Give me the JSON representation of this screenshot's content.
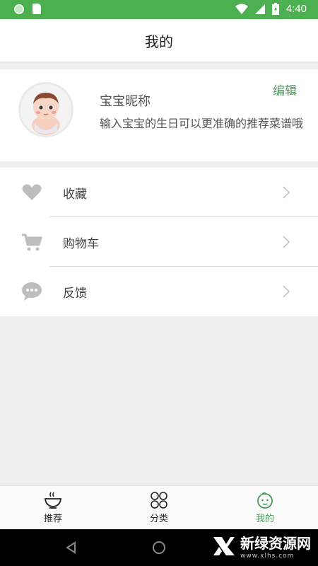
{
  "status_bar": {
    "time": "4:40"
  },
  "header": {
    "title": "我的"
  },
  "profile": {
    "nickname": "宝宝昵称",
    "edit_label": "编辑",
    "birthday_hint": "输入宝宝的生日可以更准确的推荐菜谱哦"
  },
  "menu": {
    "items": [
      {
        "label": "收藏",
        "icon": "heart-icon"
      },
      {
        "label": "购物车",
        "icon": "cart-icon"
      },
      {
        "label": "反馈",
        "icon": "chat-bubble-icon"
      }
    ]
  },
  "bottom_nav": {
    "items": [
      {
        "label": "推荐",
        "icon": "bowl-icon",
        "active": false
      },
      {
        "label": "分类",
        "icon": "grid-icon",
        "active": false
      },
      {
        "label": "我的",
        "icon": "baby-face-icon",
        "active": true
      }
    ]
  },
  "watermark": {
    "title": "新绿资源网",
    "subtitle": "www.xlhs.com"
  },
  "colors": {
    "accent": "#4caf50",
    "link": "#4a9a5a",
    "icon_gray": "#bdbdbd"
  }
}
